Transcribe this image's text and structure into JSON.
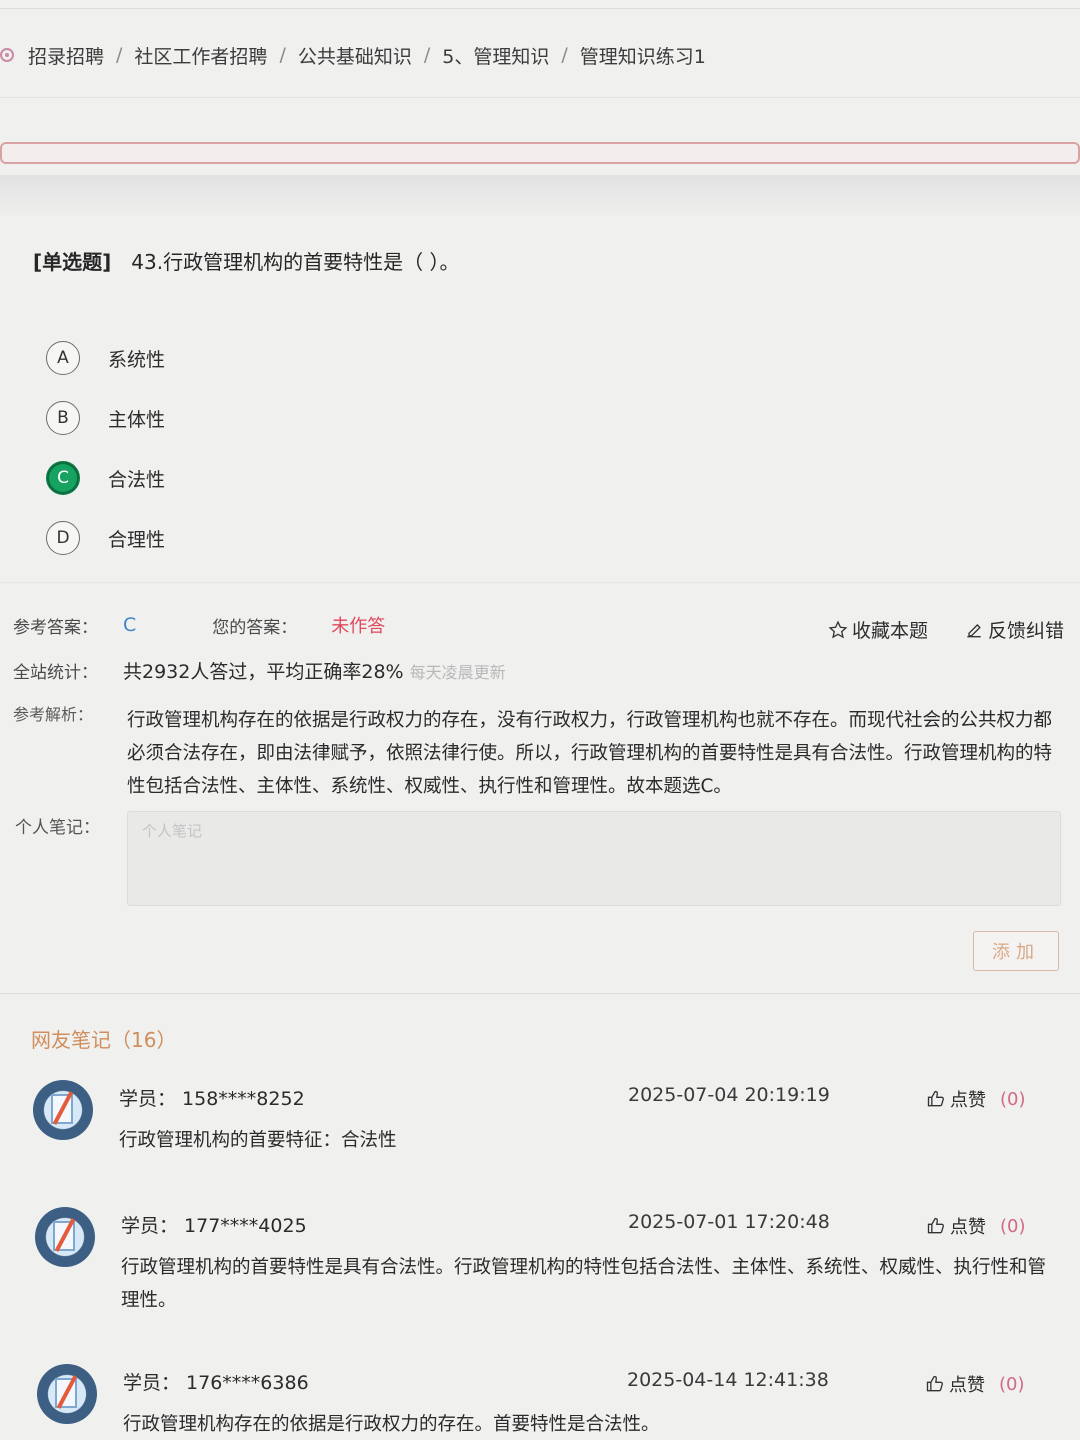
{
  "breadcrumb": [
    "招录招聘",
    "社区工作者招聘",
    "公共基础知识",
    "5、管理知识",
    "管理知识练习1"
  ],
  "question": {
    "type": "[单选题]",
    "text": "43.行政管理机构的首要特性是（  ）。",
    "options": [
      {
        "letter": "A",
        "text": "系统性",
        "selected": false
      },
      {
        "letter": "B",
        "text": "主体性",
        "selected": false
      },
      {
        "letter": "C",
        "text": "合法性",
        "selected": true
      },
      {
        "letter": "D",
        "text": "合理性",
        "selected": false
      }
    ]
  },
  "result": {
    "ref_answer_label": "参考答案：",
    "ref_answer": "C",
    "your_answer_label": "您的答案：",
    "your_answer": "未作答",
    "favorite": "收藏本题",
    "feedback": "反馈纠错",
    "stats_label": "全站统计：",
    "stats_text": "共2932人答过，平均正确率28%",
    "stats_note": "每天凌晨更新",
    "analysis_label": "参考解析：",
    "analysis": "行政管理机构存在的依据是行政权力的存在，没有行政权力，行政管理机构也就不存在。而现代社会的公共权力都必须合法存在，即由法律赋予，依照法律行使。所以，行政管理机构的首要特性是具有合法性。行政管理机构的特性包括合法性、主体性、系统性、权威性、执行性和管理性。故本题选C。",
    "note_label": "个人笔记：",
    "note_placeholder": "个人笔记",
    "add_button": "添加"
  },
  "notes": {
    "title": "网友笔记（16）",
    "items": [
      {
        "student": "学员：  158****8252",
        "time": "2025-07-04 20:19:19",
        "like": "点赞",
        "count": "(0)",
        "content": "行政管理机构的首要特征：合法性"
      },
      {
        "student": "学员：  177****4025",
        "time": "2025-07-01 17:20:48",
        "like": "点赞",
        "count": "(0)",
        "content": "行政管理机构的首要特性是具有合法性。行政管理机构的特性包括合法性、主体性、系统性、权威性、执行性和管理性。"
      },
      {
        "student": "学员：  176****6386",
        "time": "2025-04-14 12:41:38",
        "like": "点赞",
        "count": "(0)",
        "content": "行政管理机构存在的依据是行政权力的存在。首要特性是合法性。"
      }
    ]
  },
  "colors": {
    "accent_green": "#16a260",
    "answer_blue": "#3f86c9",
    "not_done_red": "#e0485c",
    "notes_title_orange": "#d08e5c"
  }
}
